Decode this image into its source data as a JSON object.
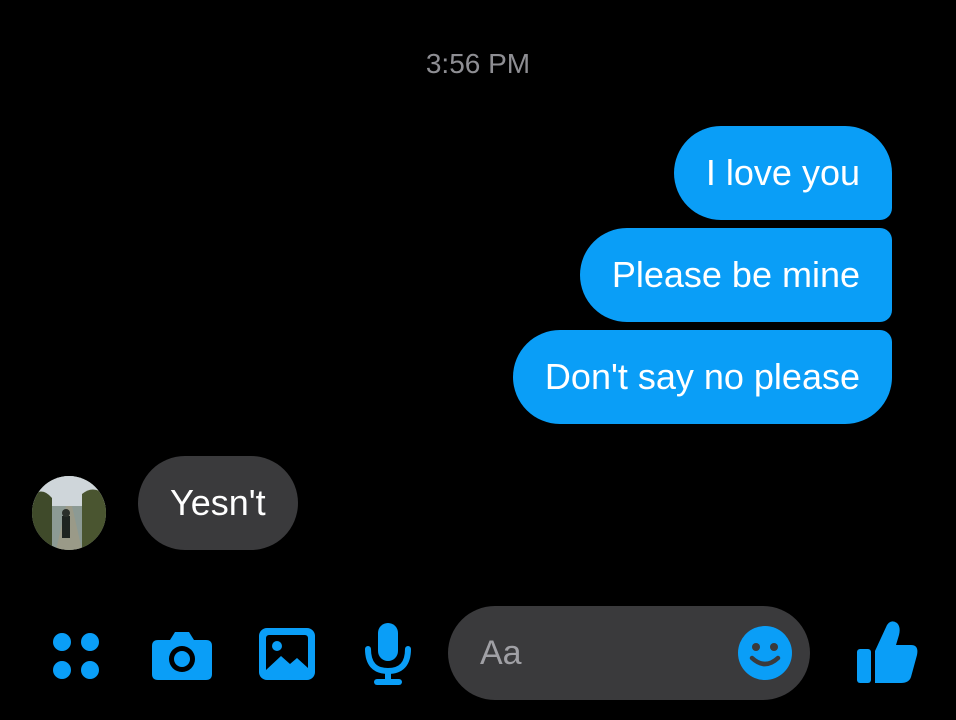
{
  "timestamp": "3:56 PM",
  "colors": {
    "accent": "#0a9ef7",
    "background": "#000000",
    "incoming_bubble": "#3a3a3c",
    "timestamp": "#8e8e93"
  },
  "messages": {
    "outgoing": [
      {
        "text": "I love you"
      },
      {
        "text": "Please be mine"
      },
      {
        "text": "Don't say no please"
      }
    ],
    "incoming": [
      {
        "text": "Yesn't"
      }
    ]
  },
  "composer": {
    "placeholder": "Aa",
    "icons": [
      "more-apps-icon",
      "camera-icon",
      "gallery-icon",
      "microphone-icon",
      "emoji-icon",
      "thumbs-up-icon"
    ]
  }
}
